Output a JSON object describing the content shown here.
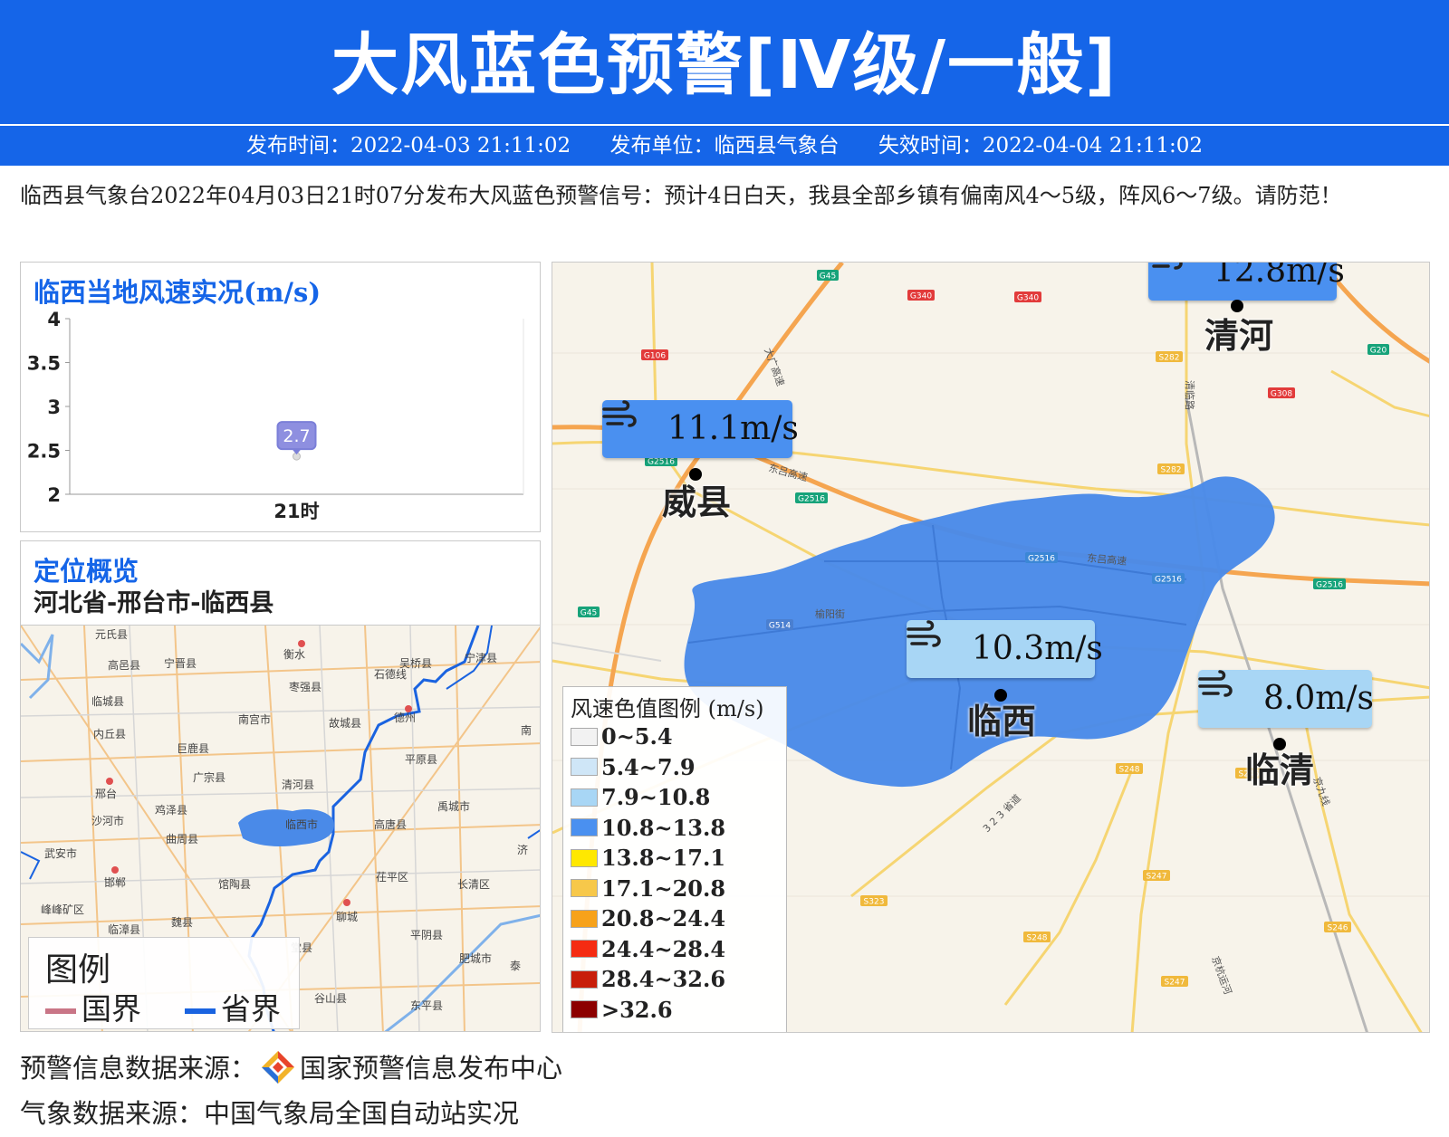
{
  "header": {
    "title": "大风蓝色预警[Ⅳ级/一般]",
    "publish_time": "发布时间：2022-04-03 21:11:02",
    "publisher": "发布单位：临西县气象台",
    "expire_time": "失效时间：2022-04-04 21:11:02"
  },
  "description": "临西县气象台2022年04月03日21时07分发布大风蓝色预警信号：预计4日白天，我县全部乡镇有偏南风4～5级，阵风6～7级。请防范！",
  "wind_chart": {
    "title": "临西当地风速实况(m/s)",
    "chart_data": {
      "type": "scatter",
      "title": "临西当地风速实况(m/s)",
      "categories": [
        "21时"
      ],
      "values": [
        2.7
      ],
      "data_labels": [
        "2.7"
      ],
      "ylim": [
        2,
        4
      ],
      "yticks": [
        "4",
        "3.5",
        "3",
        "2.5",
        "2"
      ],
      "ytick_values": [
        4,
        3.5,
        3,
        2.5,
        2
      ],
      "marker_color": "#7b7fd8",
      "label_bg": "#8e8fe0"
    }
  },
  "overview": {
    "title": "定位概览",
    "region": "河北省-邢台市-临西县",
    "places": [
      "元氏县",
      "衡水",
      "宁津县",
      "高邑县",
      "宁晋县",
      "吴桥县",
      "枣强县",
      "临城县",
      "石德线",
      "南宫市",
      "故城县",
      "德州",
      "内丘县",
      "巨鹿县",
      "平原县",
      "广宗县",
      "邢台",
      "清河县",
      "沙河市",
      "鸡泽县",
      "临西市",
      "禹城市",
      "曲周县",
      "高唐县",
      "武安市",
      "邯郸",
      "馆陶县",
      "茌平区",
      "长清区",
      "峰峰矿区",
      "魏县",
      "聊城",
      "平阴县",
      "临漳县",
      "肥城市",
      "东平县",
      "谷山县",
      "泰",
      "济",
      "南",
      "堂县"
    ],
    "legend_title": "图例",
    "legend_country": "国界",
    "legend_province": "省界",
    "country_color": "#c97586",
    "province_color": "#1a63e0"
  },
  "main_map": {
    "stations": [
      {
        "name": "清河",
        "wind": "12.8m/s",
        "level": "strong"
      },
      {
        "name": "威县",
        "wind": "11.1m/s",
        "level": "strong"
      },
      {
        "name": "临西",
        "wind": "10.3m/s",
        "level": "medium"
      },
      {
        "name": "临清",
        "wind": "8.0m/s",
        "level": "medium"
      }
    ],
    "road_labels": [
      "G45",
      "G340",
      "G340",
      "G106",
      "G20",
      "S282",
      "G308",
      "S282",
      "G2516",
      "G2516",
      "G2516",
      "G2516",
      "G2516",
      "G45",
      "G514",
      "S248",
      "S246",
      "S248",
      "S247",
      "S323",
      "S248",
      "S247",
      "S246"
    ],
    "road_names": [
      "大广高速",
      "清临路",
      "东吕高速",
      "东吕高速",
      "榆阳街",
      "3 2 3 省道",
      "京九线",
      "京杭运河"
    ],
    "warning_area_color": "#4a8ae8",
    "legend": {
      "title": "风速色值图例 (m/s)",
      "items": [
        {
          "range": "0~5.4",
          "color": "#f2f2f2"
        },
        {
          "range": "5.4~7.9",
          "color": "#cfe6f7"
        },
        {
          "range": "7.9~10.8",
          "color": "#a8d6f5"
        },
        {
          "range": "10.8~13.8",
          "color": "#4a90f0"
        },
        {
          "range": "13.8~17.1",
          "color": "#ffe800"
        },
        {
          "range": "17.1~20.8",
          "color": "#f7c84a"
        },
        {
          "range": "20.8~24.4",
          "color": "#f7a21a"
        },
        {
          "range": "24.4~28.4",
          "color": "#f52b12"
        },
        {
          "range": "28.4~32.6",
          "color": "#c81e0a"
        },
        {
          "range": ">32.6",
          "color": "#8c0000"
        }
      ]
    }
  },
  "footer": {
    "warning_source_label": "预警信息数据来源：",
    "warning_source": "国家预警信息发布中心",
    "weather_source": "气象数据来源：中国气象局全国自动站实况"
  }
}
